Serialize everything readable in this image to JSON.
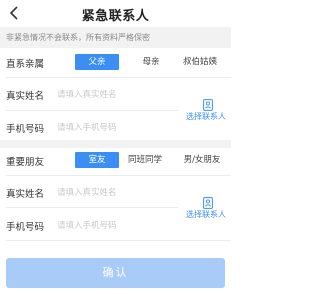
{
  "header": {
    "title": "紧急联系人"
  },
  "notice": "非紧急情况不会联系，所有资料严格保密",
  "section1": {
    "relation_label": "直系亲属",
    "options": [
      "父亲",
      "母亲",
      "叔伯姑姨"
    ],
    "selected_index": 0,
    "name_label": "真实姓名",
    "name_placeholder": "请填入真实姓名",
    "phone_label": "手机号码",
    "phone_placeholder": "请填入手机号码",
    "select_contact": "选择联系人"
  },
  "section2": {
    "relation_label": "重要朋友",
    "options": [
      "室友",
      "同班同学",
      "男/女朋友"
    ],
    "selected_index": 0,
    "name_label": "真实姓名",
    "name_placeholder": "请填入真实姓名",
    "phone_label": "手机号码",
    "phone_placeholder": "请填入手机号码",
    "select_contact": "选择联系人"
  },
  "confirm_label": "确认",
  "colors": {
    "accent": "#3b8ff4",
    "button_disabled": "#a9cbf7",
    "muted_bg": "#f2f2f2"
  },
  "icons": {
    "back": "chevron-left-icon",
    "contact": "contact-book-icon"
  }
}
